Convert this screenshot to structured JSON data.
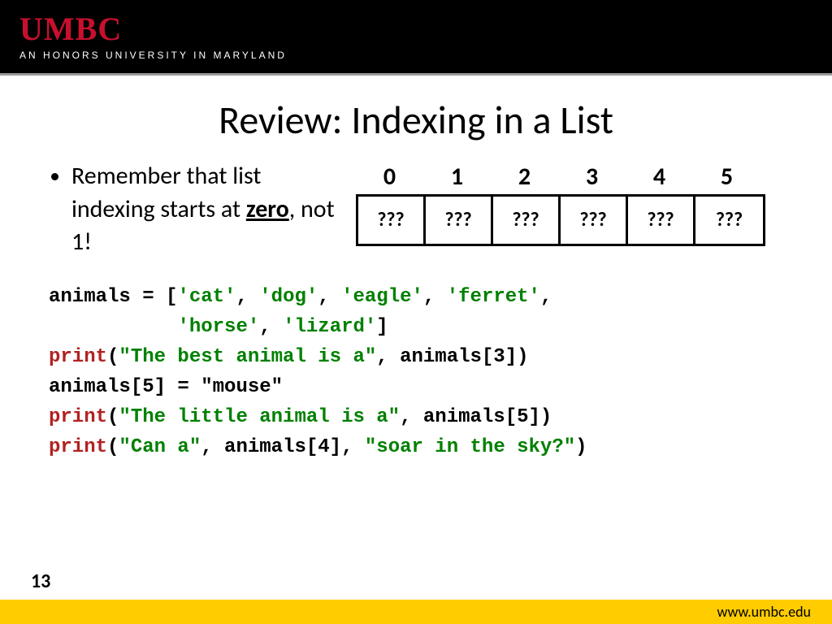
{
  "header": {
    "logo": "UMBC",
    "tagline": "AN HONORS UNIVERSITY IN MARYLAND"
  },
  "title": "Review: Indexing in a List",
  "bullet": {
    "prefix": "Remember that list indexing starts at ",
    "emph": "zero",
    "suffix": ", not 1!"
  },
  "indices": [
    "0",
    "1",
    "2",
    "3",
    "4",
    "5"
  ],
  "cells": [
    "???",
    "???",
    "???",
    "???",
    "???",
    "???"
  ],
  "code": {
    "l1a": "animals = [",
    "l1b": "'cat'",
    "l1c": ", ",
    "l1d": "'dog'",
    "l1e": ", ",
    "l1f": "'eagle'",
    "l1g": ", ",
    "l1h": "'ferret'",
    "l1i": ",",
    "l2a": "           ",
    "l2b": "'horse'",
    "l2c": ", ",
    "l2d": "'lizard'",
    "l2e": "]",
    "l3a": "print",
    "l3b": "(",
    "l3c": "\"The best animal is a\"",
    "l3d": ", animals[3])",
    "l4": "animals[5] = \"mouse\"",
    "l5a": "print",
    "l5b": "(",
    "l5c": "\"The little animal is a\"",
    "l5d": ", animals[5])",
    "l6a": "print",
    "l6b": "(",
    "l6c": "\"Can a\"",
    "l6d": ", animals[4], ",
    "l6e": "\"soar in the sky?\"",
    "l6f": ")"
  },
  "page_number": "13",
  "footer_url": "www.umbc.edu"
}
